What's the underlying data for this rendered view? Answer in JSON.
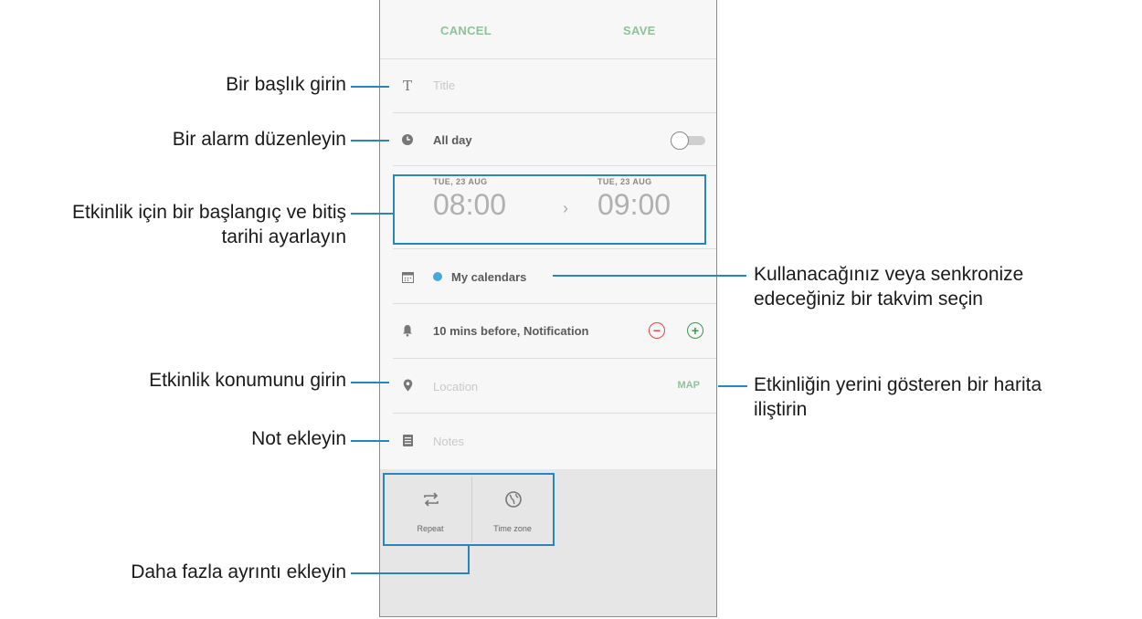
{
  "form": {
    "cancel_label": "CANCEL",
    "save_label": "SAVE",
    "title_placeholder": "Title",
    "all_day_label": "All day",
    "start": {
      "date": "TUE, 23 AUG",
      "time": "08:00"
    },
    "end": {
      "date": "TUE, 23 AUG",
      "time": "09:00"
    },
    "arrow": "›",
    "calendar_label": "My calendars",
    "reminder_label": "10 mins before, Notification",
    "location_placeholder": "Location",
    "map_label": "MAP",
    "notes_placeholder": "Notes",
    "repeat_label": "Repeat",
    "timezone_label": "Time zone"
  },
  "annotations": {
    "title": "Bir başlık girin",
    "alarm": "Bir alarm düzenleyin",
    "dates_line1": "Etkinlik için bir başlangıç ve bitiş",
    "dates_line2": "tarihi ayarlayın",
    "calendar_line1": "Kullanacağınız veya senkronize",
    "calendar_line2": "edeceğiniz bir takvim seçin",
    "location": "Etkinlik konumunu girin",
    "map_line1": "Etkinliğin yerini gösteren bir harita",
    "map_line2": "iliştirin",
    "notes": "Not ekleyin",
    "details": "Daha fazla ayrıntı ekleyin"
  },
  "colors": {
    "accent_green": "#8cc49a",
    "highlight_blue": "#2a85b8",
    "calendar_dot": "#4aa7d6",
    "minus_red": "#e04848",
    "plus_green": "#3a9a4a"
  }
}
